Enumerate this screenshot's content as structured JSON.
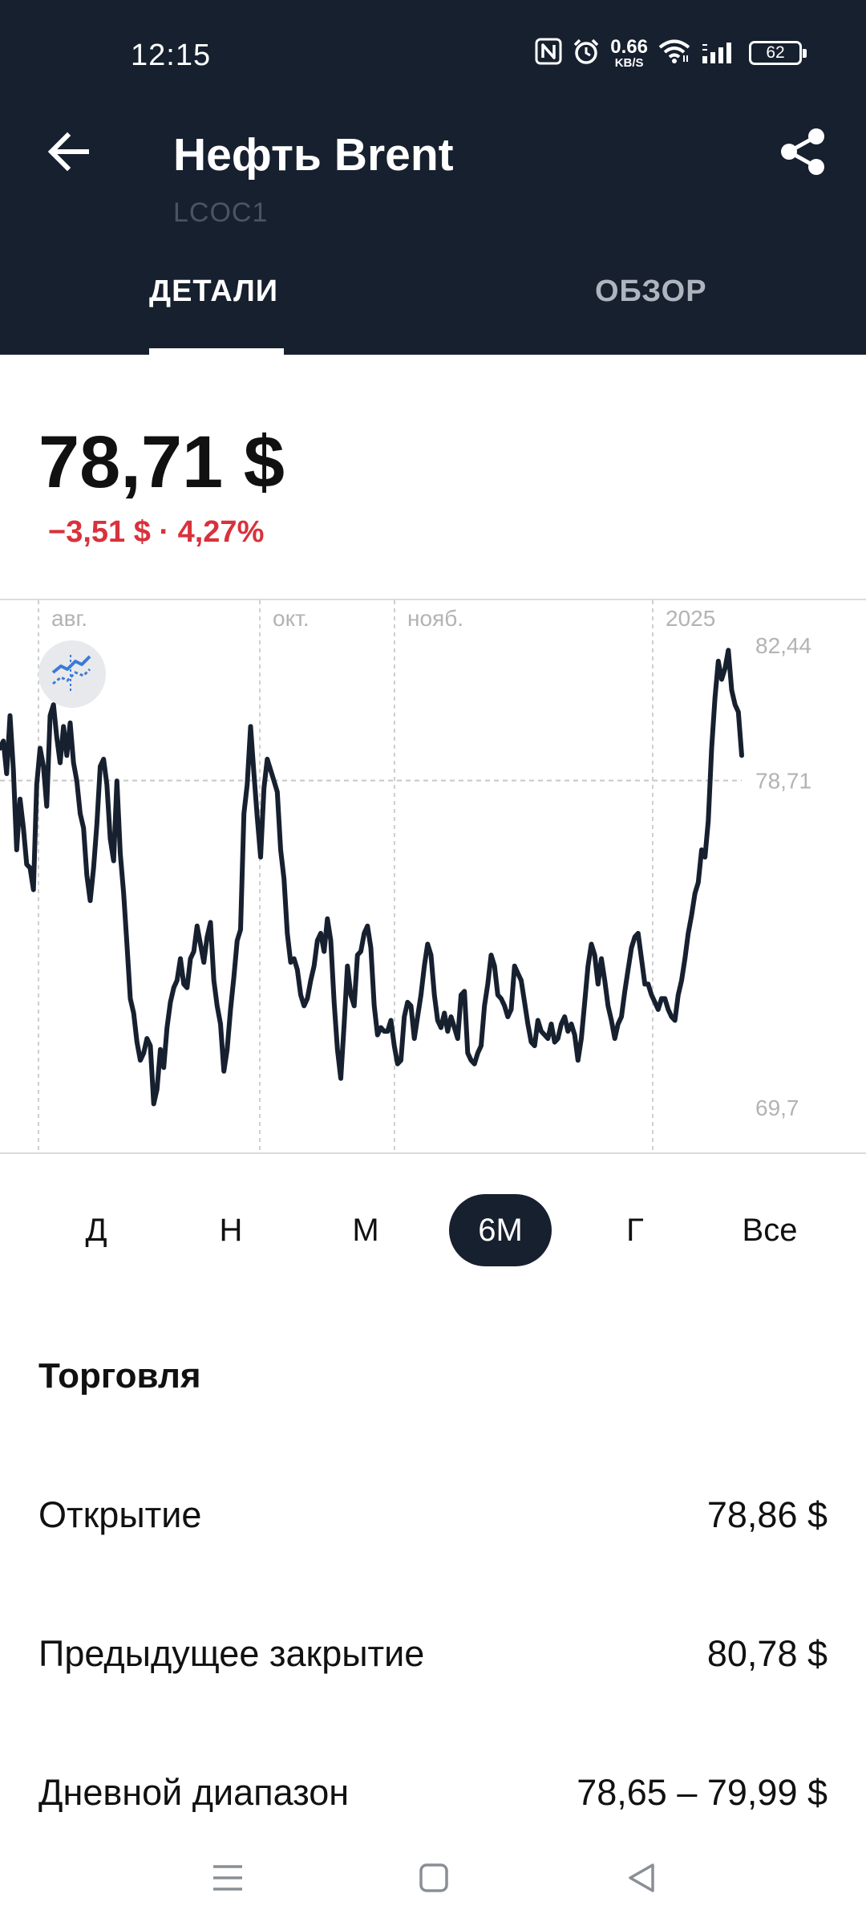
{
  "status_bar": {
    "time": "12:15",
    "net_speed": "0.66",
    "net_speed_unit": "KB/S",
    "battery": "62",
    "icons": [
      "nfc-icon",
      "alarm-icon",
      "wifi-icon",
      "signal-icon",
      "battery-icon"
    ]
  },
  "header": {
    "title": "Нефть Brent",
    "ticker": "LCOC1",
    "back_icon": "arrow-left-icon",
    "share_icon": "share-icon",
    "background_color": "#17202f"
  },
  "tabs": [
    {
      "label": "ДЕТАЛИ",
      "active": true
    },
    {
      "label": "ОБЗОР",
      "active": false
    }
  ],
  "quote": {
    "price": "78,71 $",
    "change": "−3,51 $ · 4,27%",
    "change_color": "#d8323c"
  },
  "chart_data": {
    "type": "line",
    "x_labels": [
      "авг.",
      "окт.",
      "нояб.",
      "2025"
    ],
    "y_labels": [
      "82,44",
      "78,71",
      "69,7"
    ],
    "ylim": [
      69.7,
      82.44
    ],
    "reference_line": 78.71,
    "grid": "vertical dashed at month boundaries",
    "line_color": "#17202f",
    "series": [
      {
        "values": [
          79.6,
          79.8,
          78.9,
          80.5,
          79.0,
          76.8,
          78.2,
          77.4,
          76.4,
          76.3,
          75.7,
          78.6,
          79.6,
          79.1,
          78.0,
          80.5,
          80.8,
          79.9,
          79.2,
          80.2,
          79.4,
          80.3,
          79.2,
          78.7,
          77.8,
          77.4,
          76.1,
          75.4,
          76.3,
          77.5,
          79.1,
          79.3,
          78.6,
          77.1,
          76.5,
          78.7,
          76.7,
          75.6,
          74.2,
          72.7,
          72.3,
          71.5,
          71.0,
          71.2,
          71.6,
          71.4,
          69.8,
          70.2,
          71.3,
          70.8,
          71.9,
          72.6,
          73.0,
          73.2,
          73.8,
          73.1,
          73.0,
          73.8,
          74.0,
          74.7,
          74.2,
          73.7,
          74.4,
          74.8,
          73.2,
          72.5,
          72.0,
          70.7,
          71.3,
          72.4,
          73.3,
          74.3,
          74.6,
          77.8,
          78.6,
          80.2,
          78.9,
          77.7,
          76.6,
          78.5,
          79.3,
          79.0,
          78.7,
          78.4,
          76.8,
          76.0,
          74.5,
          73.7,
          73.8,
          73.5,
          72.8,
          72.5,
          72.7,
          73.2,
          73.6,
          74.3,
          74.5,
          74.0,
          74.9,
          74.3,
          72.6,
          71.3,
          70.5,
          72.0,
          73.6,
          72.8,
          72.5,
          73.9,
          74.0,
          74.5,
          74.7,
          74.1,
          72.5,
          71.7,
          71.9,
          71.8,
          71.8,
          72.1,
          71.4,
          70.9,
          71.0,
          72.2,
          72.6,
          72.5,
          71.6,
          72.2,
          72.8,
          73.6,
          74.2,
          73.9,
          72.8,
          72.1,
          71.9,
          72.3,
          71.8,
          72.2,
          71.9,
          71.6,
          72.8,
          72.9,
          71.2,
          71.0,
          70.9,
          71.2,
          71.4,
          72.5,
          73.1,
          73.9,
          73.6,
          72.8,
          72.7,
          72.5,
          72.2,
          72.4,
          73.6,
          73.4,
          73.2,
          72.6,
          72.0,
          71.5,
          71.4,
          72.1,
          71.8,
          71.7,
          71.6,
          72.0,
          71.5,
          71.6,
          72.0,
          72.2,
          71.8,
          72.0,
          71.7,
          71.0,
          71.6,
          72.6,
          73.6,
          74.2,
          73.9,
          73.1,
          73.8,
          73.2,
          72.5,
          72.1,
          71.6,
          72.0,
          72.2,
          72.9,
          73.5,
          74.1,
          74.4,
          74.5,
          73.8,
          73.1,
          73.1,
          72.8,
          72.6,
          72.4,
          72.7,
          72.7,
          72.4,
          72.2,
          72.1,
          72.8,
          73.2,
          73.8,
          74.5,
          75.0,
          75.6,
          75.9,
          76.8,
          76.6,
          77.6,
          79.6,
          81.0,
          82.0,
          81.5,
          81.8,
          82.3,
          81.2,
          80.8,
          80.6,
          79.4
        ],
        "date_start": "2024-07-22",
        "date_end": "2025-01-21"
      }
    ]
  },
  "range_selector": {
    "options": [
      "Д",
      "Н",
      "М",
      "6М",
      "Г",
      "Все"
    ],
    "selected": "6М"
  },
  "trading": {
    "title": "Торговля",
    "rows": [
      {
        "label": "Открытие",
        "value": "78,86 $"
      },
      {
        "label": "Предыдущее закрытие",
        "value": "80,78 $"
      },
      {
        "label": "Дневной диапазон",
        "value": "78,65 – 79,99 $"
      }
    ]
  },
  "nav_bar": {
    "icons": [
      "menu-icon",
      "home-square-icon",
      "back-triangle-icon"
    ]
  }
}
